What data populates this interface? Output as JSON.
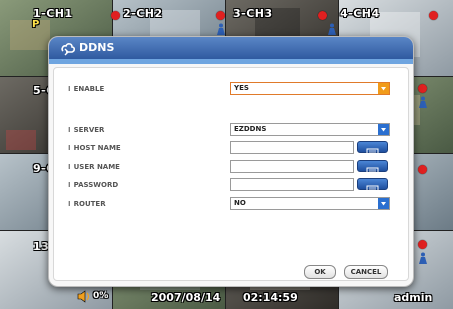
{
  "channels": [
    {
      "label": "1-CH1"
    },
    {
      "label": "2-CH2"
    },
    {
      "label": "3-CH3"
    },
    {
      "label": "4-CH4"
    },
    {
      "label": "5-C"
    },
    {
      "label": "9-C"
    },
    {
      "label": "13"
    },
    {
      "label": "P"
    }
  ],
  "dialog": {
    "title": "DDNS",
    "rows": {
      "enable": {
        "label": "ENABLE",
        "value": "YES"
      },
      "server": {
        "label": "SERVER",
        "value": "EZDDNS"
      },
      "host_name": {
        "label": "HOST NAME",
        "value": ""
      },
      "user_name": {
        "label": "USER NAME",
        "value": ""
      },
      "password": {
        "label": "PASSWORD",
        "value": ""
      },
      "router": {
        "label": "ROUTER",
        "value": "NO"
      }
    },
    "ok_label": "OK",
    "cancel_label": "CANCEL"
  },
  "statusbar": {
    "volume": "0%",
    "date": "2007/08/14",
    "time": "02:14:59",
    "user": "admin"
  },
  "colors": {
    "accent_blue": "#2f5aa0",
    "enable_orange": "#e07a2a",
    "record_red": "#e02020"
  }
}
